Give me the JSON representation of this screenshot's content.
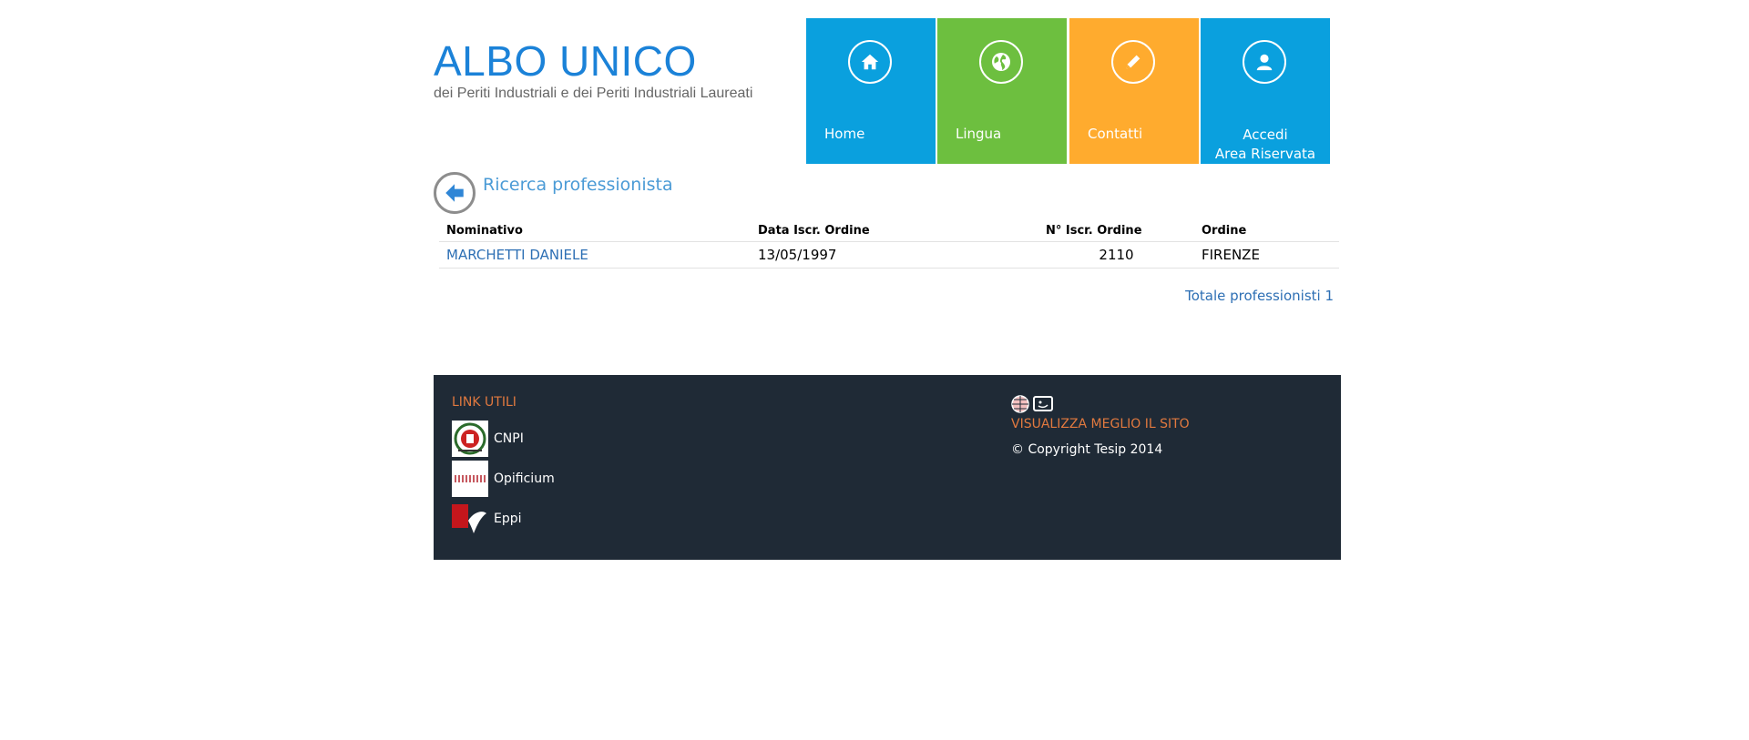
{
  "header": {
    "title": "ALBO UNICO",
    "subtitle": "dei Periti Industriali e dei Periti Industriali Laureati"
  },
  "nav": {
    "tiles": [
      {
        "label": "Home",
        "icon": "home-icon",
        "color": "#0aa0de"
      },
      {
        "label": "Lingua",
        "icon": "globe-icon",
        "color": "#6dbf3f"
      },
      {
        "label": "Contatti",
        "icon": "pencil-icon",
        "color": "#ffab2e"
      },
      {
        "label_line1": "Accedi",
        "label_line2": "Area Riservata",
        "icon": "user-icon",
        "color": "#0aa0de"
      }
    ]
  },
  "section": {
    "title": "Ricerca professionista",
    "back_icon": "arrow-left-icon"
  },
  "table": {
    "headers": [
      "Nominativo",
      "Data Iscr. Ordine",
      "N° Iscr. Ordine",
      "Ordine"
    ],
    "rows": [
      {
        "nominativo": "MARCHETTI DANIELE",
        "data": "13/05/1997",
        "numero": "2110",
        "ordine": "FIRENZE"
      }
    ]
  },
  "total": "Totale professionisti 1",
  "footer": {
    "links_heading": "LINK UTILI",
    "links": [
      {
        "label": "CNPI"
      },
      {
        "label": "Opificium"
      },
      {
        "label": "Eppi"
      }
    ],
    "accessibility_heading": "VISUALIZZA MEGLIO IL SITO",
    "copyright": "© Copyright Tesip 2014",
    "heading_color": "#e1793f",
    "background": "#1f2a36"
  }
}
